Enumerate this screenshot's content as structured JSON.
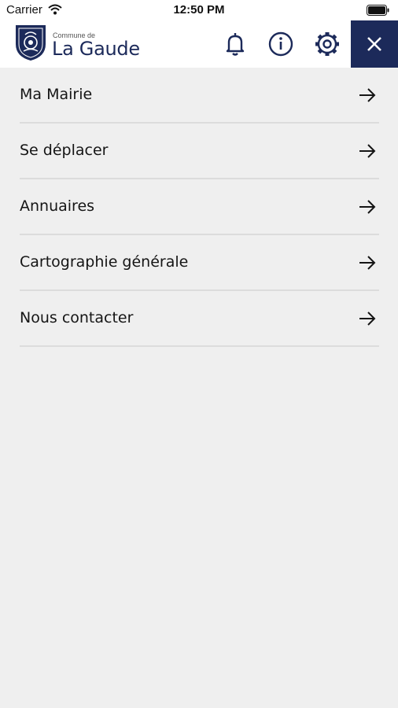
{
  "status": {
    "carrier": "Carrier",
    "time": "12:50 PM"
  },
  "header": {
    "logo_subtitle": "Commune de",
    "logo_title": "La Gaude",
    "icons": [
      "bell-icon",
      "info-icon",
      "gear-icon",
      "close-icon"
    ],
    "accent_color": "#1c2a5a"
  },
  "menu": {
    "items": [
      {
        "label": "Ma Mairie"
      },
      {
        "label": "Se déplacer"
      },
      {
        "label": "Annuaires"
      },
      {
        "label": "Cartographie générale"
      },
      {
        "label": "Nous contacter"
      }
    ]
  }
}
